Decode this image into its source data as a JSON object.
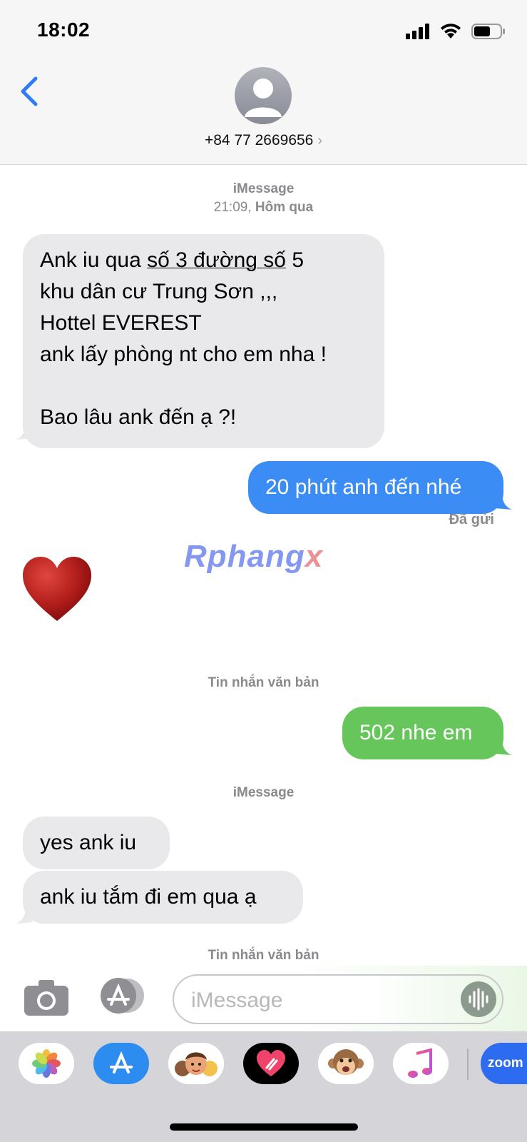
{
  "status_bar": {
    "time": "18:02"
  },
  "header": {
    "contact": "+84 77 2669656",
    "chevron": "›"
  },
  "messages": {
    "meta1": {
      "service": "iMessage",
      "time": "21:09,",
      "day": "Hôm qua"
    },
    "msg1": {
      "line1_pre": "Ank  iu qua ",
      "line1_link": "số 3 đường số",
      "line1_post": " 5",
      "line2": "khu dân cư Trung Sơn ,,,",
      "line3": "Hottel EVEREST",
      "line4": "ank lấy phòng nt cho em nha !",
      "line5": "Bao lâu ank đến ạ ?!"
    },
    "msg2": "20 phút anh đến nhé",
    "delivered": "Đã gửi",
    "watermark_main": "Rphang",
    "watermark_tail": "x",
    "meta2": "Tin nhắn văn bản",
    "msg3": "502 nhe em",
    "meta3": "iMessage",
    "msg4": "yes ank iu",
    "msg5": "ank iu tắm đi em qua ạ",
    "meta4": "Tin nhắn văn bản"
  },
  "input": {
    "placeholder": "iMessage"
  },
  "drawer": {
    "apps": [
      "photos-icon",
      "app-store-icon",
      "memoji-icon",
      "digital-touch-icon",
      "animoji-icon",
      "music-icon",
      "zoom-icon"
    ],
    "zoom_label": "zoom"
  },
  "colors": {
    "blue": "#3b8df5",
    "green": "#66c65b",
    "incoming": "#e9e9eb"
  }
}
